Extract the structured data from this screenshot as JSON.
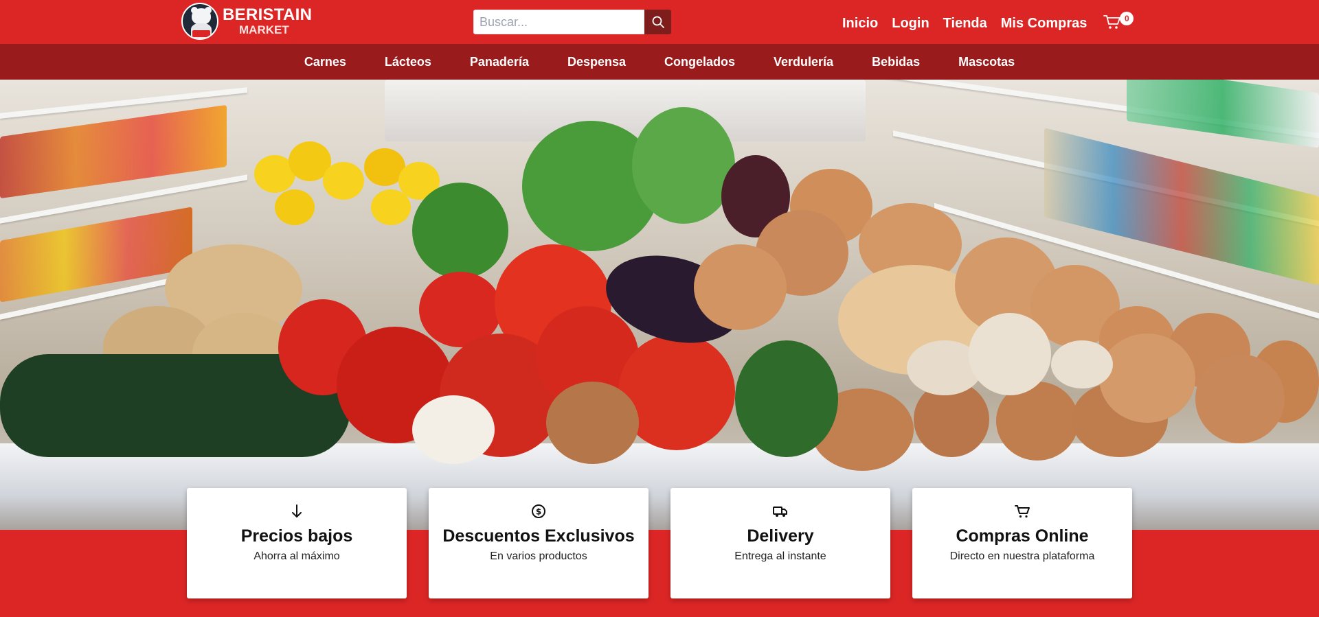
{
  "brand": {
    "line1": "BERISTAIN",
    "line2": "MARKET"
  },
  "search": {
    "placeholder": "Buscar..."
  },
  "topnav": {
    "items": [
      "Inicio",
      "Login",
      "Tienda",
      "Mis Compras"
    ]
  },
  "cart": {
    "count": "0"
  },
  "categories": [
    "Carnes",
    "Lácteos",
    "Panadería",
    "Despensa",
    "Congelados",
    "Verdulería",
    "Bebidas",
    "Mascotas"
  ],
  "features": [
    {
      "icon": "arrow-down-icon",
      "title": "Precios bajos",
      "subtitle": "Ahorra al máximo"
    },
    {
      "icon": "dollar-circle-icon",
      "title": "Descuentos Exclusivos",
      "subtitle": "En varios productos"
    },
    {
      "icon": "truck-icon",
      "title": "Delivery",
      "subtitle": "Entrega al instante"
    },
    {
      "icon": "cart-icon",
      "title": "Compras Online",
      "subtitle": "Directo en nuestra plataforma"
    }
  ],
  "colors": {
    "primary": "#dc2626",
    "secondary": "#991b1b",
    "search_button": "#7f1d1d"
  }
}
